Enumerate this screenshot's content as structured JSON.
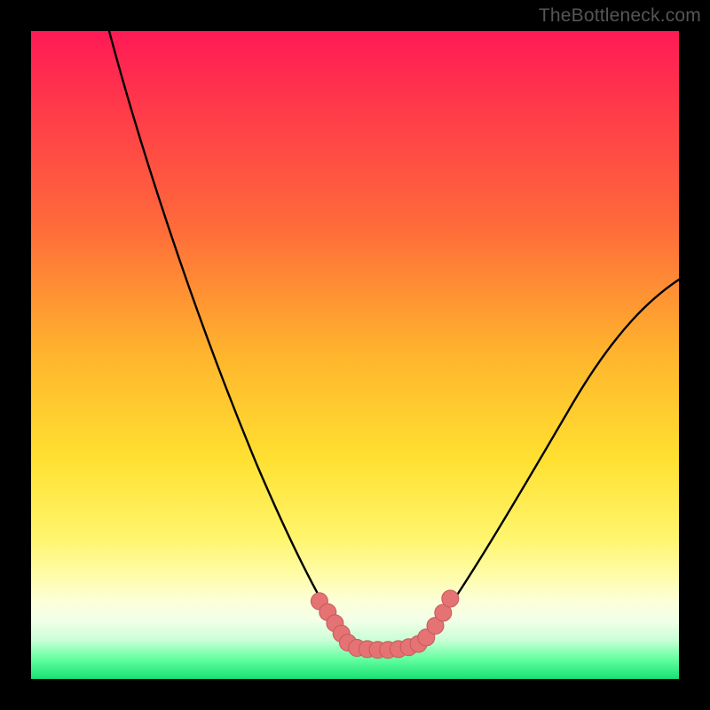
{
  "watermark": "TheBottleneck.com",
  "colors": {
    "gradient_top": "#ff1a55",
    "gradient_mid_orange": "#ff9a33",
    "gradient_yellow": "#ffe031",
    "gradient_cream": "#fffca8",
    "gradient_green": "#18e074",
    "curve": "#000000",
    "marker_fill": "#e57373",
    "marker_stroke": "#c45a5a",
    "frame_bg": "#000000"
  },
  "chart_data": {
    "type": "line",
    "title": "",
    "xlabel": "",
    "ylabel": "",
    "xlim": [
      0,
      100
    ],
    "ylim": [
      0,
      100
    ],
    "series": [
      {
        "name": "left-curve",
        "x": [
          12,
          14,
          18,
          22,
          26,
          30,
          34,
          38,
          42,
          45,
          47,
          49
        ],
        "values": [
          100,
          92,
          78,
          64,
          51,
          39,
          28,
          19,
          12,
          8,
          6,
          5
        ]
      },
      {
        "name": "right-curve",
        "x": [
          60,
          63,
          66,
          70,
          75,
          80,
          86,
          93,
          100
        ],
        "values": [
          5,
          6,
          8,
          12,
          18,
          26,
          36,
          48,
          62
        ]
      },
      {
        "name": "valley-floor",
        "x": [
          49,
          52,
          55,
          58,
          60
        ],
        "values": [
          5,
          4.5,
          4.5,
          4.5,
          5
        ]
      }
    ],
    "markers": [
      {
        "x": 44.5,
        "y": 12.0,
        "r": 1.3
      },
      {
        "x": 45.8,
        "y": 10.3,
        "r": 1.3
      },
      {
        "x": 46.9,
        "y": 8.6,
        "r": 1.3
      },
      {
        "x": 47.9,
        "y": 7.0,
        "r": 1.3
      },
      {
        "x": 48.9,
        "y": 5.6,
        "r": 1.3
      },
      {
        "x": 50.3,
        "y": 4.8,
        "r": 1.3
      },
      {
        "x": 51.9,
        "y": 4.6,
        "r": 1.3
      },
      {
        "x": 53.5,
        "y": 4.5,
        "r": 1.3
      },
      {
        "x": 55.1,
        "y": 4.5,
        "r": 1.3
      },
      {
        "x": 56.7,
        "y": 4.6,
        "r": 1.3
      },
      {
        "x": 58.3,
        "y": 4.9,
        "r": 1.3
      },
      {
        "x": 59.8,
        "y": 5.4,
        "r": 1.3
      },
      {
        "x": 61.0,
        "y": 6.4,
        "r": 1.3
      },
      {
        "x": 62.4,
        "y": 8.2,
        "r": 1.3
      },
      {
        "x": 63.6,
        "y": 10.2,
        "r": 1.3
      },
      {
        "x": 64.7,
        "y": 12.4,
        "r": 1.3
      }
    ],
    "gradient_stops": [
      {
        "pct": 0,
        "color": "#ff1a55"
      },
      {
        "pct": 30,
        "color": "#ff6a3a"
      },
      {
        "pct": 66,
        "color": "#ffe031"
      },
      {
        "pct": 88,
        "color": "#fcffd9"
      },
      {
        "pct": 100,
        "color": "#18e074"
      }
    ]
  }
}
